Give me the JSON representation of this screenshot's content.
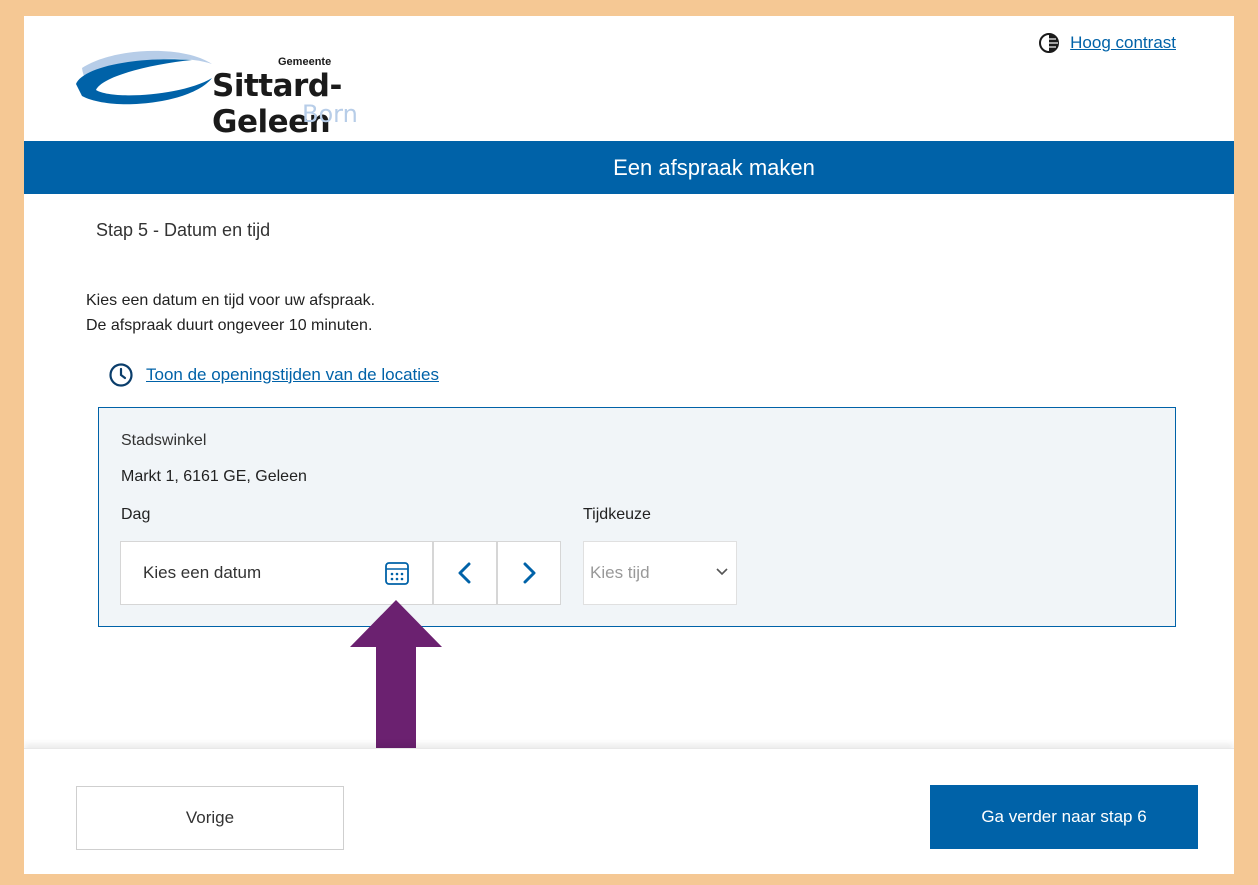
{
  "header": {
    "logo_small": "Gemeente",
    "logo_main": "Sittard-Geleen",
    "logo_sub": "Born",
    "contrast_label": "Hoog contrast"
  },
  "band": {
    "title": "Een afspraak maken"
  },
  "step": {
    "title": "Stap 5 - Datum en tijd"
  },
  "description": {
    "line1": "Kies een datum en tijd voor uw afspraak.",
    "line2": "De afspraak duurt ongeveer 10 minuten."
  },
  "hours_link": "Toon de openingstijden van de locaties",
  "location": {
    "name": "Stadswinkel",
    "address": "Markt 1, 6161 GE, Geleen",
    "day_label": "Dag",
    "date_placeholder": "Kies een datum",
    "time_label": "Tijdkeuze",
    "time_placeholder": "Kies tijd"
  },
  "footer": {
    "prev_label": "Vorige",
    "next_label": "Ga verder naar stap 6"
  },
  "colors": {
    "brand_blue": "#0062a8",
    "frame_orange": "#f5c894",
    "arrow_purple": "#6b2170",
    "panel_bg": "#f1f5f8"
  },
  "icons": {
    "contrast": "half-circle-contrast-icon",
    "clock": "clock-icon",
    "calendar": "calendar-icon",
    "prev": "chevron-left-icon",
    "next": "chevron-right-icon",
    "select": "chevron-down-icon",
    "annotation": "arrow-up-annotation"
  }
}
